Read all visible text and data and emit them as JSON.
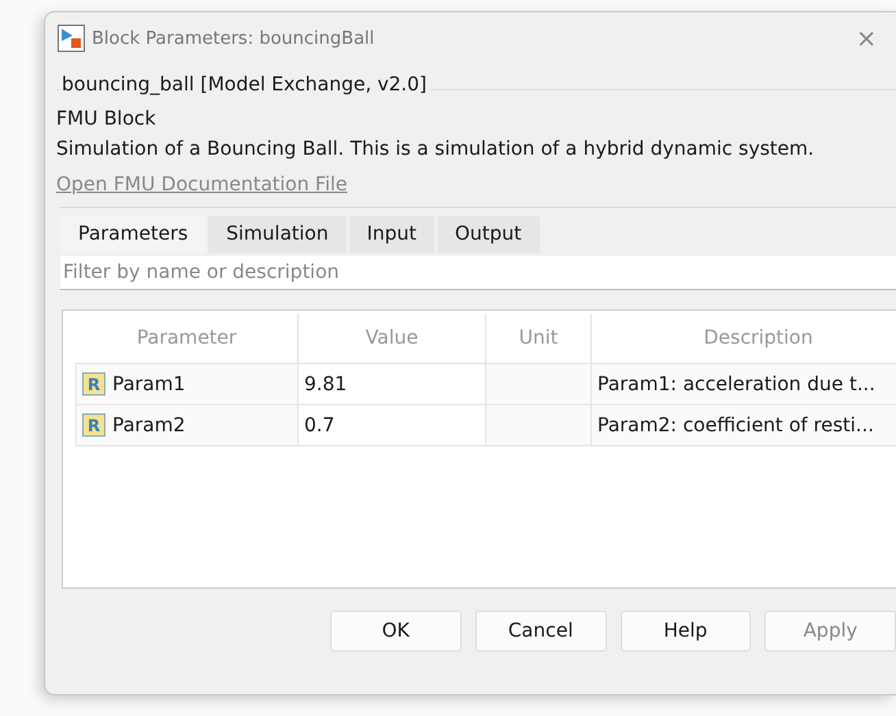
{
  "window": {
    "title": "Block Parameters: bouncingBall",
    "close": "×"
  },
  "group_title": "bouncing_ball [Model Exchange, v2.0]",
  "block_type": "FMU Block",
  "description": "Simulation of a Bouncing Ball. This is a simulation of a hybrid dynamic system.",
  "doc_link": "Open FMU Documentation File",
  "tabs": [
    {
      "label": "Parameters",
      "selected": true
    },
    {
      "label": "Simulation",
      "selected": false
    },
    {
      "label": "Input",
      "selected": false
    },
    {
      "label": "Output",
      "selected": false
    }
  ],
  "filter": {
    "placeholder": "Filter by name or description"
  },
  "table": {
    "columns": [
      "Parameter",
      "Value",
      "Unit",
      "Description"
    ],
    "rows": [
      {
        "badge": "R",
        "name": "Param1",
        "value": "9.81",
        "unit": "",
        "description": "Param1: acceleration due t..."
      },
      {
        "badge": "R",
        "name": "Param2",
        "value": "0.7",
        "unit": "",
        "description": "Param2: coefficient of resti..."
      }
    ]
  },
  "buttons": [
    {
      "label": "OK",
      "disabled": false
    },
    {
      "label": "Cancel",
      "disabled": false
    },
    {
      "label": "Help",
      "disabled": false
    },
    {
      "label": "Apply",
      "disabled": true
    }
  ]
}
